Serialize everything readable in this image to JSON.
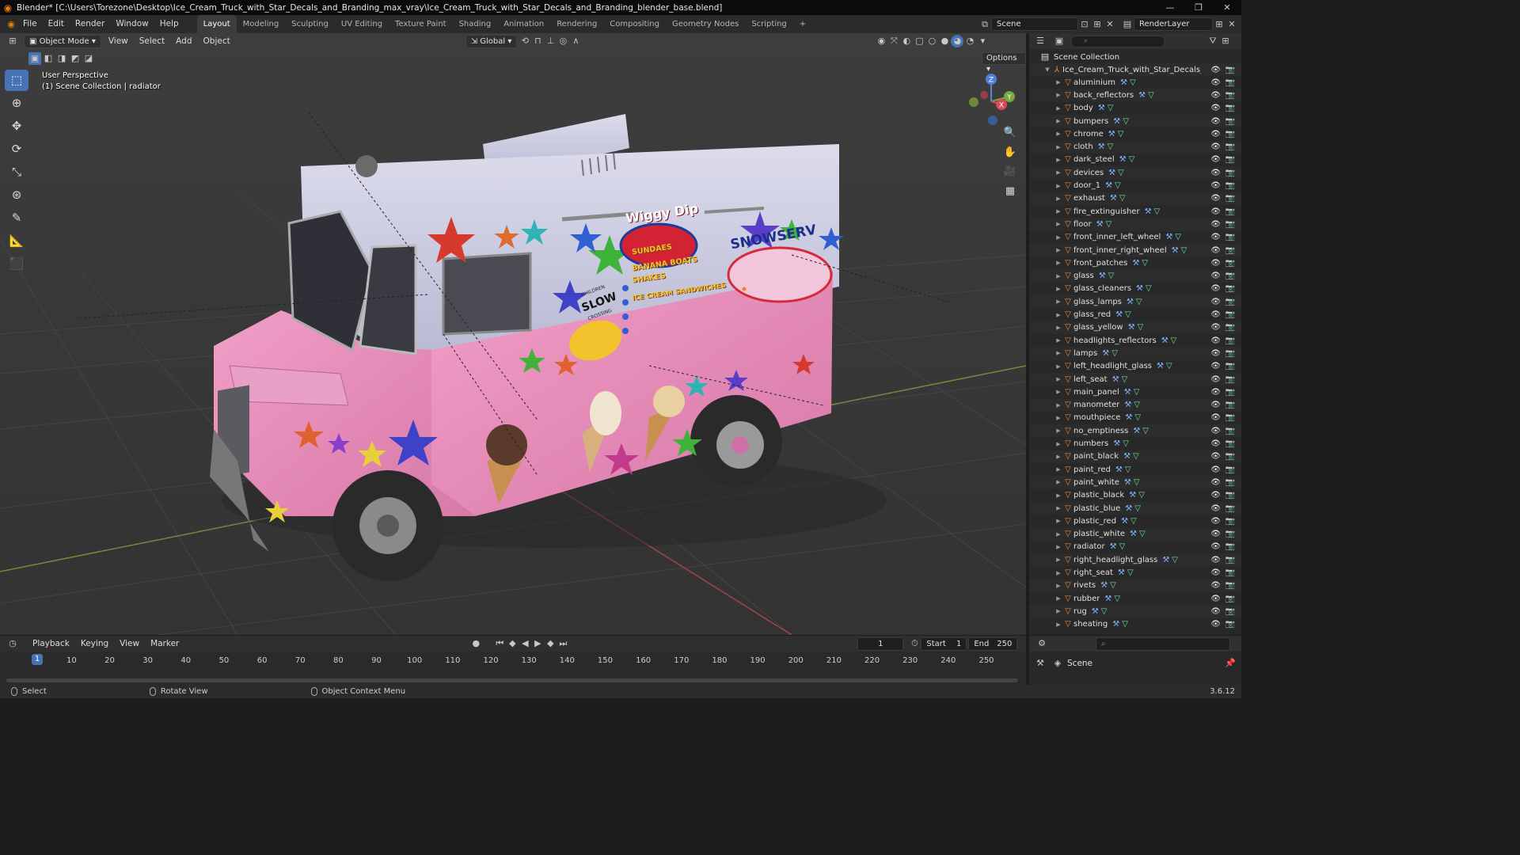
{
  "window": {
    "title": "Blender* [C:\\Users\\Torezone\\Desktop\\Ice_Cream_Truck_with_Star_Decals_and_Branding_max_vray\\Ice_Cream_Truck_with_Star_Decals_and_Branding_blender_base.blend]",
    "controls": [
      "—",
      "❐",
      "✕"
    ]
  },
  "menu": [
    "File",
    "Edit",
    "Render",
    "Window",
    "Help"
  ],
  "workspaces": [
    "Layout",
    "Modeling",
    "Sculpting",
    "UV Editing",
    "Texture Paint",
    "Shading",
    "Animation",
    "Rendering",
    "Compositing",
    "Geometry Nodes",
    "Scripting",
    "+"
  ],
  "active_workspace": "Layout",
  "scene_field": "Scene",
  "renderlayer_field": "RenderLayer",
  "viewport": {
    "mode": "Object Mode",
    "menus": [
      "View",
      "Select",
      "Add",
      "Object"
    ],
    "transform_orientation": "Global",
    "options_label": "Options",
    "perspective_label": "User Perspective",
    "collection_label": "(1) Scene Collection | radiator",
    "gizmo_axes": [
      "X",
      "Y",
      "Z"
    ]
  },
  "decals": {
    "brand1": "Wiggy Dip",
    "brand2": "SNOWSERV",
    "menu_items": [
      "SUNDAES",
      "BANANA BOATS",
      "SHAKES",
      "ICE CREAM SANDWICHES"
    ],
    "sign_small": "CHILDREN",
    "sign_big": "SLOW",
    "sign_bottom": "CROSSING"
  },
  "outliner": {
    "search_placeholder": "",
    "root": "Scene Collection",
    "collection": "Ice_Cream_Truck_with_Star_Decals_and",
    "items": [
      "aluminium",
      "back_reflectors",
      "body",
      "bumpers",
      "chrome",
      "cloth",
      "dark_steel",
      "devices",
      "door_1",
      "exhaust",
      "fire_extinguisher",
      "floor",
      "front_inner_left_wheel",
      "front_inner_right_wheel",
      "front_patches",
      "glass",
      "glass_cleaners",
      "glass_lamps",
      "glass_red",
      "glass_yellow",
      "headlights_reflectors",
      "lamps",
      "left_headlight_glass",
      "left_seat",
      "main_panel",
      "manometer",
      "mouthpiece",
      "no_emptiness",
      "numbers",
      "paint_black",
      "paint_red",
      "paint_white",
      "plastic_black",
      "plastic_blue",
      "plastic_red",
      "plastic_white",
      "radiator",
      "right_headlight_glass",
      "right_seat",
      "rivets",
      "rubber",
      "rug",
      "sheating"
    ]
  },
  "timeline": {
    "menus": [
      "Playback",
      "Keying",
      "View",
      "Marker"
    ],
    "current_frame": "1",
    "start_label": "Start",
    "start_value": "1",
    "end_label": "End",
    "end_value": "250",
    "ticks": [
      "1",
      "10",
      "20",
      "30",
      "40",
      "50",
      "60",
      "70",
      "80",
      "90",
      "100",
      "110",
      "120",
      "130",
      "140",
      "150",
      "160",
      "170",
      "180",
      "190",
      "200",
      "210",
      "220",
      "230",
      "240",
      "250"
    ]
  },
  "properties": {
    "scene": "Scene"
  },
  "statusbar": {
    "select": "Select",
    "rotate": "Rotate View",
    "context": "Object Context Menu",
    "version": "3.6.12"
  },
  "colors": {
    "accent": "#4772b3",
    "truck_pink": "#e889b6",
    "truck_white": "#c9cbe0",
    "object_orange": "#e89040"
  }
}
